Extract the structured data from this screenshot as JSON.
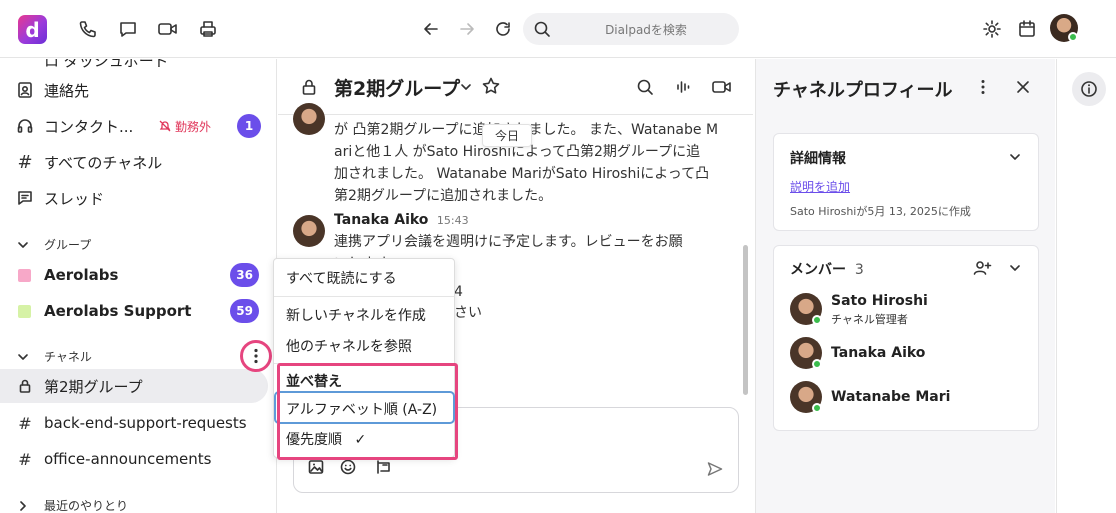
{
  "topbar": {
    "logo_letter": "d",
    "search_placeholder": "Dialpadを検索"
  },
  "sidebar": {
    "cut_item": "ロ ダッシュボード",
    "items": [
      {
        "label": "連絡先",
        "icon": "contacts-icon"
      },
      {
        "label": "コンタクト...",
        "icon": "headset-icon",
        "status": "勤務外",
        "badge": "1"
      },
      {
        "label": "すべてのチャネル",
        "icon": "hash-icon"
      },
      {
        "label": "スレッド",
        "icon": "threads-icon"
      }
    ],
    "groups_header": "グループ",
    "groups": [
      {
        "label": "Aerolabs",
        "badge": "36",
        "color": "#f7a8c8"
      },
      {
        "label": "Aerolabs Support",
        "badge": "59",
        "color": "#d6f2a6"
      }
    ],
    "channels_header": "チャネル",
    "channels": [
      {
        "label": "第2期グループ",
        "active": true
      },
      {
        "label": "back-end-support-requests"
      },
      {
        "label": "office-announcements"
      }
    ],
    "recent_header": "最近のやりとり"
  },
  "channel": {
    "title": "第2期グループ",
    "date_chip": "今日",
    "system_message": [
      "が 凸第2期グループに追加されました。 また、Watanabe M",
      "ariと他１人 がSato Hiroshiによって凸第2期グループに追",
      "加されました。 Watanabe MariがSato Hiroshiによって凸",
      "第2期グループに追加されました。"
    ],
    "message": {
      "author": "Tanaka Aiko",
      "time": "15:43",
      "line1": "連携アプリ会議を週明けに予定します。レビューをお願",
      "line2": "いします。",
      "partial1": "4",
      "partial2": "さい"
    }
  },
  "menu": {
    "mark_all_read": "すべて既読にする",
    "create_channel": "新しいチャネルを作成",
    "browse_channels": "他のチャネルを参照",
    "sort_header": "並べ替え",
    "sort_alpha": "アルファベット順 (A-Z)",
    "sort_priority": "優先度順",
    "checkmark": "✓"
  },
  "profile": {
    "title": "チャネルプロフィール",
    "details_header": "詳細情報",
    "add_description": "説明を追加",
    "created_by": "Sato Hiroshiが5月 13, 2025に作成",
    "members_header": "メンバー",
    "members_count": "3",
    "members": [
      {
        "name": "Sato Hiroshi",
        "role": "チャネル管理者"
      },
      {
        "name": "Tanaka Aiko",
        "role": ""
      },
      {
        "name": "Watanabe Mari",
        "role": ""
      }
    ]
  },
  "colors": {
    "accent": "#6b4eea",
    "highlight": "#e6457f",
    "focus": "#5e9ad8",
    "link": "#6b4eea",
    "online": "#3bbd4d"
  }
}
